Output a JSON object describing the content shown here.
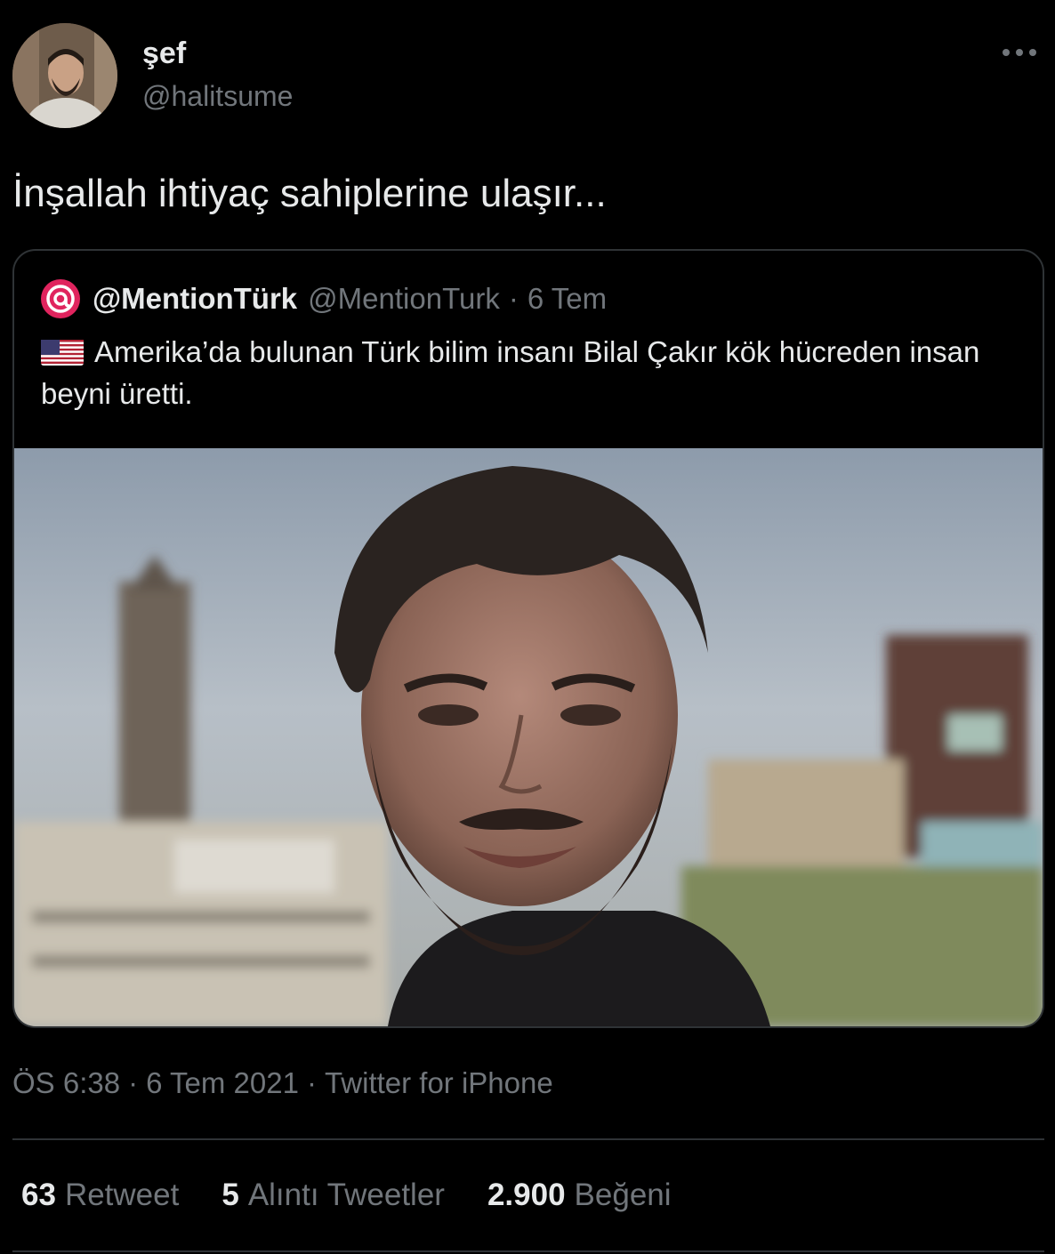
{
  "author": {
    "display_name": "şef",
    "handle": "@halitsume",
    "avatar_icon": "profile-photo"
  },
  "more_icon": "more-horizontal-icon",
  "tweet": {
    "text": "İnşallah ihtiyaç sahiplerine ulaşır..."
  },
  "quoted_tweet": {
    "avatar_icon": "mention-at-logo",
    "display_name": "@MentionTürk",
    "handle": "@MentionTurk",
    "separator": "·",
    "date": "6 Tem",
    "flag_icon": "us-flag-emoji",
    "text": "Amerika’da bulunan Türk bilim insanı Bilal Çakır kök hücreden insan beyni üretti.",
    "image_icon": "man-portrait-photo"
  },
  "meta": {
    "time": "ÖS 6:38",
    "separator": "·",
    "date": "6 Tem 2021",
    "source": "Twitter for iPhone"
  },
  "stats": {
    "retweets": {
      "count": "63",
      "label": "Retweet"
    },
    "quotes": {
      "count": "5",
      "label": "Alıntı Tweetler"
    },
    "likes": {
      "count": "2.900",
      "label": "Beğeni"
    }
  },
  "colors": {
    "background": "#000000",
    "text_primary": "#e7e9ea",
    "text_secondary": "#71767b",
    "border": "#2f3336",
    "mention_brand": "#e0245e"
  }
}
